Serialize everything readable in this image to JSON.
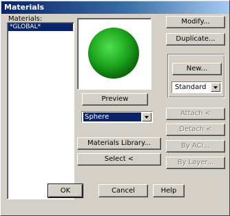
{
  "window": {
    "title": "Materials"
  },
  "materials_list": {
    "label": "Materials:",
    "items": [
      "*GLOBAL*"
    ]
  },
  "preview": {
    "button_label": "Preview",
    "shape_select": "Sphere"
  },
  "right_panel": {
    "modify": "Modify...",
    "duplicate": "Duplicate...",
    "new": "New...",
    "type_select": "Standard",
    "attach": "Attach <",
    "detach": "Detach <",
    "by_aci": "By ACI...",
    "by_layer": "By Layer..."
  },
  "middle_buttons": {
    "materials_library": "Materials Library...",
    "select": "Select <"
  },
  "footer": {
    "ok": "OK",
    "cancel": "Cancel",
    "help": "Help"
  },
  "colors": {
    "title_start": "#0a246a",
    "title_end": "#a6caf0",
    "face": "#d4d0c8",
    "selection": "#0a246a",
    "sphere": "#22aa22"
  },
  "icons": [
    "dropdown-arrow-icon",
    "green-sphere-preview"
  ]
}
